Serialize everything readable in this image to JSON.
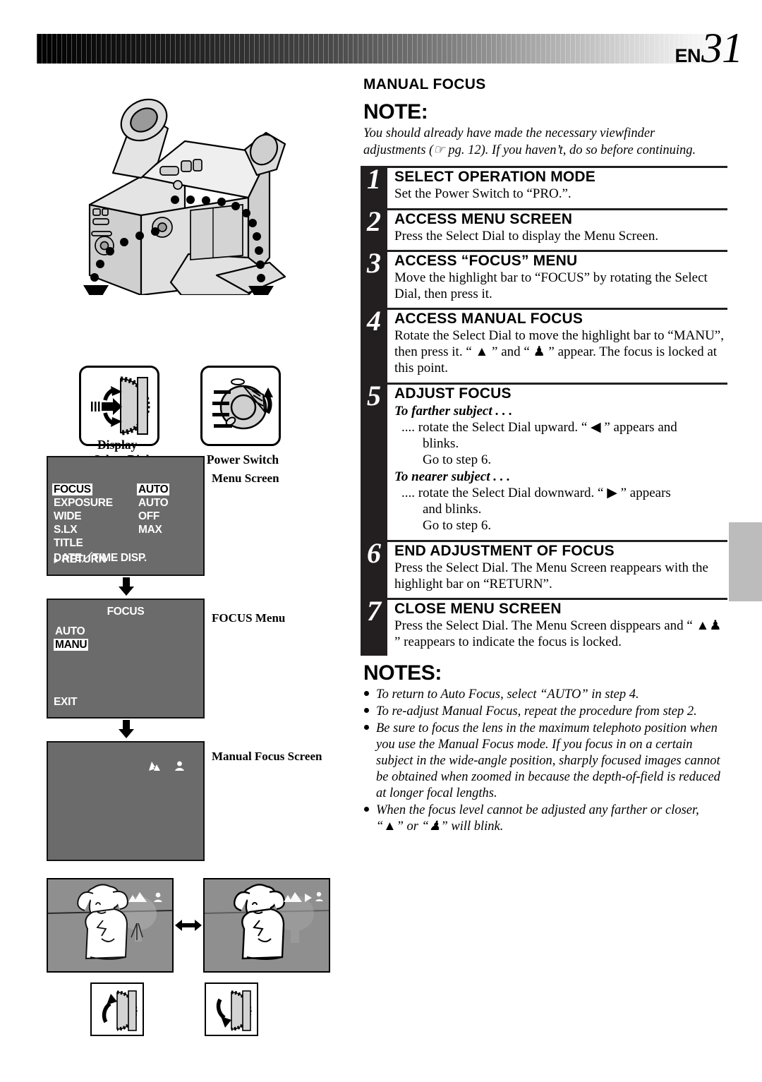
{
  "header": {
    "page_prefix": "EN",
    "page_number": "31"
  },
  "section": {
    "title": "MANUAL FOCUS",
    "note_heading": "NOTE:",
    "note_body": "You should already have made the necessary viewfinder adjustments (☞ pg. 12). If you haven’t, do so before continuing."
  },
  "steps": [
    {
      "num": "1",
      "heading": "SELECT OPERATION MODE",
      "text": "Set the Power Switch to “PRO.”."
    },
    {
      "num": "2",
      "heading": "ACCESS MENU SCREEN",
      "text": "Press the Select Dial to display the Menu Screen."
    },
    {
      "num": "3",
      "heading": "ACCESS “FOCUS” MENU",
      "text": "Move the highlight bar to “FOCUS” by rotating the Select Dial, then press it."
    },
    {
      "num": "4",
      "heading": "ACCESS MANUAL FOCUS",
      "text": "Rotate the Select Dial to move the highlight bar to “MANU”, then press it. “ ▲ ” and “ ♟ ” appear. The focus is locked at this point."
    },
    {
      "num": "5",
      "heading": "ADJUST FOCUS",
      "sub": [
        {
          "head": "To farther subject . . .",
          "line1": ".... rotate the Select Dial upward. “ ◀ ” appears and",
          "line2": "blinks.",
          "line3": "Go to step 6."
        },
        {
          "head": "To nearer subject . . .",
          "line1": ".... rotate the Select Dial downward. “ ▶ ” appears",
          "line2": "and blinks.",
          "line3": "Go to step 6."
        }
      ]
    },
    {
      "num": "6",
      "heading": "END ADJUSTMENT OF FOCUS",
      "text": "Press the Select Dial. The Menu Screen reappears with the highlight bar on “RETURN”."
    },
    {
      "num": "7",
      "heading": "CLOSE MENU SCREEN",
      "text": "Press the Select Dial. The Menu Screen disppears and “ ▲♟ ” reappears to indicate the focus is locked."
    }
  ],
  "notes": {
    "heading": "NOTES:",
    "items": [
      "To return to Auto Focus, select “AUTO” in step 4.",
      "To re-adjust Manual Focus, repeat the procedure from step 2.",
      "Be sure to focus the lens in the maximum telephoto position when you use the Manual Focus mode. If you focus in on a certain subject in the wide-angle position, sharply focused images cannot be obtained when zoomed in because the depth-of-field is reduced at longer focal lengths.",
      "When the focus level cannot be adjusted any farther or closer, “▲” or “♟” will blink."
    ]
  },
  "diagram": {
    "select_dial_caption": "Select Dial",
    "power_switch_caption": "Power Switch",
    "display_caption": "Display"
  },
  "osd": {
    "menu_screen_label": "Menu Screen",
    "focus_menu_label": "FOCUS Menu",
    "manual_focus_label": "Manual Focus Screen",
    "menu_rows": [
      {
        "key": "FOCUS",
        "value": "AUTO",
        "key_hl": true,
        "value_hl": true
      },
      {
        "key": "EXPOSURE",
        "value": "AUTO",
        "key_hl": false,
        "value_hl": false
      },
      {
        "key": "WIDE",
        "value": "OFF",
        "key_hl": false,
        "value_hl": false
      },
      {
        "key": "S.LX",
        "value": "MAX",
        "key_hl": false,
        "value_hl": false
      },
      {
        "key": "TITLE",
        "value": "",
        "key_hl": false,
        "value_hl": false
      },
      {
        "key": "DATE／TIME  DISP.",
        "value": "",
        "key_hl": false,
        "value_hl": false
      }
    ],
    "menu_return": "RETURN",
    "focus_title": "FOCUS",
    "focus_options": [
      {
        "label": "AUTO",
        "hl": false
      },
      {
        "label": "MANU",
        "hl": true
      }
    ],
    "focus_exit": "EXIT"
  },
  "colors": {
    "osd_background": "#6b6b6b",
    "step_bar": "#231f20",
    "edge_tab": "#bcbcbc",
    "picture_background": "#8f8f8f"
  }
}
